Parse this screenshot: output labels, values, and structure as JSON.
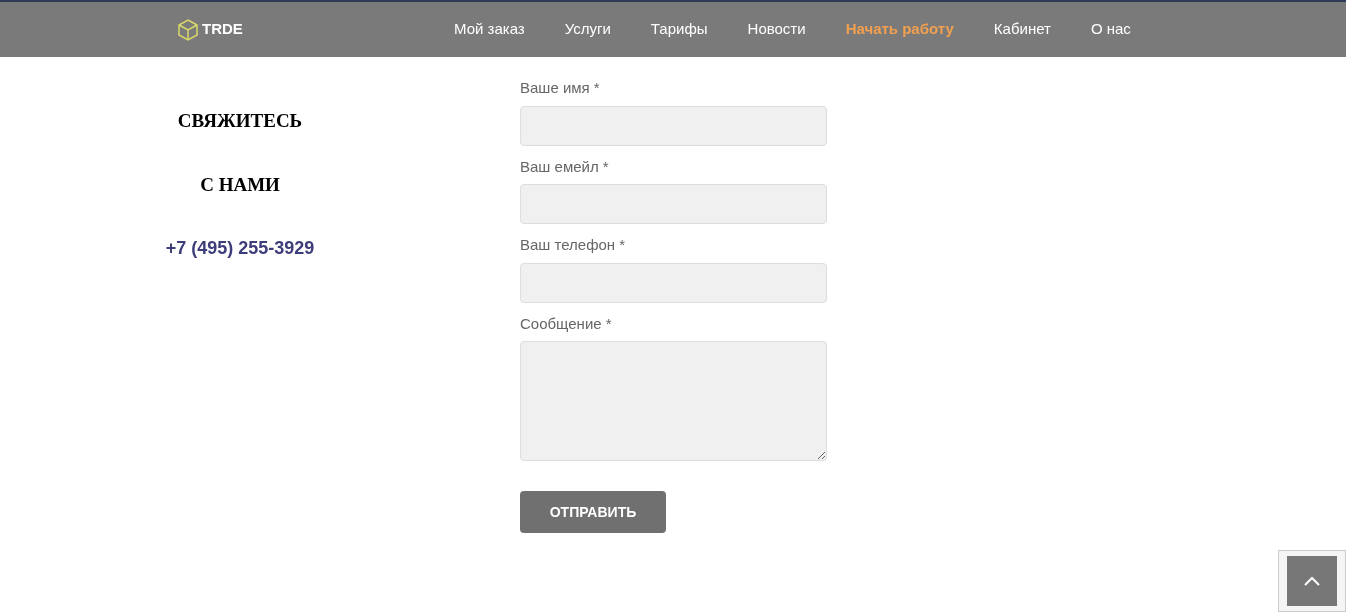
{
  "header": {
    "logo": "TRDE",
    "nav": [
      {
        "label": "Мой заказ",
        "selected": false
      },
      {
        "label": "Услуги",
        "selected": false
      },
      {
        "label": "Тарифы",
        "selected": false
      },
      {
        "label": "Новости",
        "selected": false
      },
      {
        "label": "Начать работу",
        "selected": true
      },
      {
        "label": "Кабинет",
        "selected": false
      },
      {
        "label": "О нас",
        "selected": false
      }
    ]
  },
  "contact": {
    "heading_lines": [
      "СВЯЖИТЕСЬ",
      "С НАМИ"
    ],
    "phone": "+7 (495) 255-3929"
  },
  "form": {
    "fields": [
      {
        "label": "Ваше имя *",
        "kind": "input"
      },
      {
        "label": "Ваш емейл *",
        "kind": "input"
      },
      {
        "label": "Ваш телефон *",
        "kind": "input"
      },
      {
        "label": "Сообщение *",
        "kind": "textarea"
      }
    ],
    "submit": "ОТПРАВИТЬ"
  }
}
